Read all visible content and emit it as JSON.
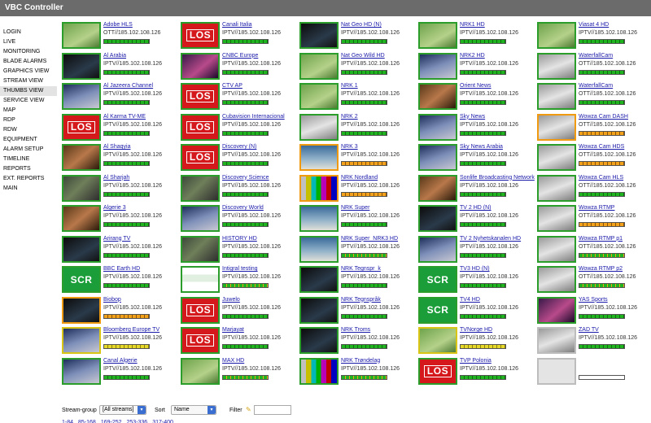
{
  "app": {
    "title": "VBC Controller"
  },
  "sidebar": {
    "items": [
      "LOGIN",
      "LIVE",
      "MONITORING",
      "BLADE ALARMS",
      "GRAPHICS VIEW",
      "STREAM VIEW",
      "THUMBS VIEW",
      "SERVICE VIEW",
      "MAP",
      "RDP",
      "RDW",
      "EQUIPMENT",
      "ALARM SETUP",
      "TIMELINE",
      "REPORTS",
      "EXT. REPORTS",
      "MAIN"
    ],
    "active": "THUMBS VIEW"
  },
  "grid": {
    "columns": [
      [
        {
          "name": "Adobe HLS",
          "addr": "OTT//185.102.108.126",
          "thumb": "green",
          "border": "green",
          "level": "green"
        },
        {
          "name": "Al Arabia",
          "addr": "IPTV//185.102.108.126",
          "thumb": "dark",
          "border": "green",
          "level": "green"
        },
        {
          "name": "Al Jazeera Channel",
          "addr": "IPTV//185.102.108.126",
          "thumb": "studio",
          "border": "green",
          "level": "green"
        },
        {
          "name": "Al Karma TV-ME",
          "addr": "IPTV//185.102.108.126",
          "thumb": "los",
          "border": "green",
          "level": "green"
        },
        {
          "name": "Al Shaqyia",
          "addr": "IPTV//185.102.108.126",
          "thumb": "warm",
          "border": "green",
          "level": "green"
        },
        {
          "name": "Al Sharjah",
          "addr": "IPTV//185.102.108.126",
          "thumb": "video",
          "border": "green",
          "level": "green"
        },
        {
          "name": "Algerie 3",
          "addr": "IPTV//185.102.108.126",
          "thumb": "warm",
          "border": "green",
          "level": "green"
        },
        {
          "name": "Arirang TV",
          "addr": "IPTV//185.102.108.126",
          "thumb": "dark",
          "border": "green",
          "level": "green"
        },
        {
          "name": "BBC Earth HD",
          "addr": "IPTV//185.102.108.126",
          "thumb": "scr",
          "border": "green",
          "level": "green"
        },
        {
          "name": "Biobop",
          "addr": "IPTV//185.102.108.126",
          "thumb": "dark",
          "border": "orange",
          "level": "orange"
        },
        {
          "name": "Bloomberg Europe TV",
          "addr": "IPTV//185.102.108.126",
          "thumb": "studio",
          "border": "yellow",
          "level": "yellow"
        },
        {
          "name": "Canal Algerie",
          "addr": "IPTV//185.102.108.126",
          "thumb": "studio",
          "border": "green",
          "level": "green"
        }
      ],
      [
        {
          "name": "Canali Italia",
          "addr": "IPTV//185.102.108.126",
          "thumb": "los",
          "border": "green",
          "level": "green"
        },
        {
          "name": "CNBC Europe",
          "addr": "IPTV//185.102.108.126",
          "thumb": "purple",
          "border": "green",
          "level": "green"
        },
        {
          "name": "CTV AP",
          "addr": "IPTV//185.102.108.126",
          "thumb": "los",
          "border": "green",
          "level": "green"
        },
        {
          "name": "Cubavision Internacional",
          "addr": "IPTV//185.102.108.126",
          "thumb": "los",
          "border": "green",
          "level": "green"
        },
        {
          "name": "Discovery (N)",
          "addr": "IPTV//185.102.108.126",
          "thumb": "los",
          "border": "green",
          "level": "green"
        },
        {
          "name": "Discovery Science",
          "addr": "IPTV//185.102.108.126",
          "thumb": "video",
          "border": "green",
          "level": "green"
        },
        {
          "name": "Discovery World",
          "addr": "IPTV//185.102.108.126",
          "thumb": "studio",
          "border": "green",
          "level": "green"
        },
        {
          "name": "HISTORY HD",
          "addr": "IPTV//185.102.108.126",
          "thumb": "video",
          "border": "green",
          "level": "green"
        },
        {
          "name": "Intigral testing",
          "addr": "IPTV//185.102.108.126",
          "thumb": "web",
          "border": "green",
          "level": "split"
        },
        {
          "name": "Juwelo",
          "addr": "IPTV//185.102.108.126",
          "thumb": "los",
          "border": "green",
          "level": "green"
        },
        {
          "name": "Marjayat",
          "addr": "IPTV//185.102.108.126",
          "thumb": "los",
          "border": "green",
          "level": "green"
        },
        {
          "name": "MAX HD",
          "addr": "IPTV//185.102.108.126",
          "thumb": "green",
          "border": "green",
          "level": "split"
        }
      ],
      [
        {
          "name": "Nat Geo HD (N)",
          "addr": "IPTV//185.102.108.126",
          "thumb": "dark",
          "border": "green",
          "level": "green"
        },
        {
          "name": "Nat Geo Wild HD",
          "addr": "IPTV//185.102.108.126",
          "thumb": "green",
          "border": "green",
          "level": "green"
        },
        {
          "name": "NRK 1",
          "addr": "IPTV//185.102.108.126",
          "thumb": "green",
          "border": "green",
          "level": "green"
        },
        {
          "name": "NRK 2",
          "addr": "IPTV//185.102.108.126",
          "thumb": "snow",
          "border": "green",
          "level": "green"
        },
        {
          "name": "NRK 3",
          "addr": "IPTV//185.102.108.126",
          "thumb": "ocean",
          "border": "orange",
          "level": "orange"
        },
        {
          "name": "NRK Nordland",
          "addr": "IPTV//185.102.108.126",
          "thumb": "bars",
          "border": "orange",
          "level": "orange"
        },
        {
          "name": "NRK Super",
          "addr": "IPTV//185.102.108.126",
          "thumb": "ocean",
          "border": "green",
          "level": "green"
        },
        {
          "name": "NRK Super_NRK3 HD",
          "addr": "IPTV//185.102.108.126",
          "thumb": "ocean",
          "border": "green",
          "level": "split"
        },
        {
          "name": "NRK Tegnspr_k",
          "addr": "IPTV//185.102.108.126",
          "thumb": "dark",
          "border": "green",
          "level": "green"
        },
        {
          "name": "NRK Tegnspråk",
          "addr": "IPTV//185.102.108.126",
          "thumb": "dark",
          "border": "green",
          "level": "green"
        },
        {
          "name": "NRK Troms",
          "addr": "IPTV//185.102.108.126",
          "thumb": "dark",
          "border": "green",
          "level": "green"
        },
        {
          "name": "NRK Trøndelag",
          "addr": "IPTV//185.102.108.126",
          "thumb": "bars",
          "border": "green",
          "level": "split"
        }
      ],
      [
        {
          "name": "NRK1 HD",
          "addr": "IPTV//185.102.108.126",
          "thumb": "green",
          "border": "green",
          "level": "green"
        },
        {
          "name": "NRK2 HD",
          "addr": "IPTV//185.102.108.126",
          "thumb": "studio",
          "border": "green",
          "level": "green"
        },
        {
          "name": "Orient News",
          "addr": "IPTV//185.102.108.126",
          "thumb": "warm",
          "border": "green",
          "level": "green"
        },
        {
          "name": "Sky News",
          "addr": "IPTV//185.102.108.126",
          "thumb": "studio",
          "border": "green",
          "level": "green"
        },
        {
          "name": "Sky News Arabia",
          "addr": "IPTV//185.102.108.126",
          "thumb": "studio",
          "border": "green",
          "level": "green"
        },
        {
          "name": "Sonlife Broadcasting Network",
          "addr": "IPTV//185.102.108.126",
          "thumb": "warm",
          "border": "green",
          "level": "green"
        },
        {
          "name": "TV 2 HD (N)",
          "addr": "IPTV//185.102.108.126",
          "thumb": "dark",
          "border": "green",
          "level": "green"
        },
        {
          "name": "TV 2 Nyhetskanalen HD",
          "addr": "IPTV//185.102.108.126",
          "thumb": "studio",
          "border": "green",
          "level": "green"
        },
        {
          "name": "TV3 HD (N)",
          "addr": "IPTV//185.102.108.126",
          "thumb": "scr",
          "border": "green",
          "level": "green"
        },
        {
          "name": "TV4 HD",
          "addr": "IPTV//185.102.108.126",
          "thumb": "scr",
          "border": "green",
          "level": "green"
        },
        {
          "name": "TVNorge HD",
          "addr": "IPTV//185.102.108.126",
          "thumb": "green",
          "border": "yellow",
          "level": "yellow"
        },
        {
          "name": "TVP Polonia",
          "addr": "IPTV//185.102.108.126",
          "thumb": "los",
          "border": "green",
          "level": "green"
        }
      ],
      [
        {
          "name": "Viasat 4 HD",
          "addr": "IPTV//185.102.108.126",
          "thumb": "green",
          "border": "green",
          "level": "green"
        },
        {
          "name": "WaterfallCam",
          "addr": "OTT//185.102.108.126",
          "thumb": "snow",
          "border": "green",
          "level": "green"
        },
        {
          "name": "WaterfallCam",
          "addr": "OTT//185.102.108.126",
          "thumb": "snow",
          "border": "green",
          "level": "green"
        },
        {
          "name": "Wowza Cam DASH",
          "addr": "OTT//185.102.108.126",
          "thumb": "snow",
          "border": "orange",
          "level": "orange"
        },
        {
          "name": "Wowza Cam HDS",
          "addr": "OTT//185.102.108.126",
          "thumb": "snow",
          "border": "green",
          "level": "orange"
        },
        {
          "name": "Wowza Cam HLS",
          "addr": "OTT//185.102.108.126",
          "thumb": "snow",
          "border": "green",
          "level": "green"
        },
        {
          "name": "Wowza RTMP",
          "addr": "OTT//185.102.108.126",
          "thumb": "snow",
          "border": "green",
          "level": "orange"
        },
        {
          "name": "Wowza RTMP p1",
          "addr": "OTT//185.102.108.126",
          "thumb": "snow",
          "border": "green",
          "level": "split"
        },
        {
          "name": "Wowza RTMP p2",
          "addr": "OTT//185.102.108.126",
          "thumb": "snow",
          "border": "green",
          "level": "split"
        },
        {
          "name": "YAS Sports",
          "addr": "IPTV//185.102.108.126",
          "thumb": "purple",
          "border": "green",
          "level": "green"
        },
        {
          "name": "ZAD TV",
          "addr": "IPTV//185.102.108.126",
          "thumb": "snow",
          "border": "gray",
          "level": "green"
        },
        {
          "name": "",
          "addr": "",
          "thumb": "blank",
          "border": "gray",
          "level": "empty"
        }
      ]
    ]
  },
  "thumb_logos": {
    "los": "LOS",
    "scr": "SCR"
  },
  "controls": {
    "stream_group_label": "Stream-group",
    "stream_group_value": "[All streams]",
    "sort_label": "Sort",
    "sort_value": "Name",
    "filter_label": "Filter"
  },
  "pages": [
    "1-84",
    "85-168",
    "169-252",
    "253-336",
    "317-400"
  ],
  "colors": {
    "titlebar": "#6b6b6b",
    "ok": "#1fb31f",
    "warn": "#f2a21a",
    "caution": "#e6d82a",
    "link": "#1a1aaa"
  }
}
